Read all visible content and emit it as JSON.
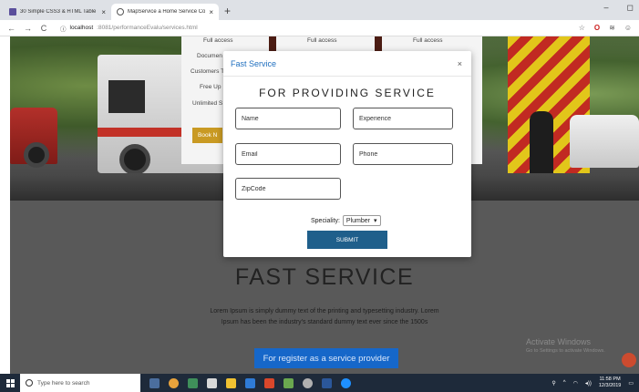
{
  "browser": {
    "tabs": [
      {
        "title": "30 Simple CSS3 & HTML Table St",
        "active": false
      },
      {
        "title": "MapService a Home Service Com",
        "active": true
      }
    ],
    "new_tab": "+",
    "url_host": "localhost",
    "url_path": ":8081/performanceEvalu/services.html",
    "window_controls": [
      "–",
      "◻"
    ]
  },
  "hero": {
    "card_labels": [
      "Full access",
      "Full access",
      "Full access"
    ],
    "card_items": [
      "Documen",
      "Customers T",
      "Free Up",
      "Unlimited S"
    ],
    "card_button": "Book N"
  },
  "section": {
    "title": "FAST SERVICE",
    "lorem": "Lorem Ipsum is simply dummy text of the printing and typesetting industry. Lorem Ipsum has been the industry's standard dummy text ever since the 1500s",
    "register_button": "For register as a service provider"
  },
  "watermark": {
    "title": "Activate Windows",
    "subtitle": "Go to Settings to activate Windows."
  },
  "modal": {
    "title": "Fast Service",
    "close": "×",
    "heading": "FOR PROVIDING SERVICE",
    "fields": {
      "name": "Name",
      "experience": "Experience",
      "email": "Email",
      "phone": "Phone",
      "zipcode": "ZipCode"
    },
    "speciality_label": "Speciality:",
    "speciality_value": "Plumber",
    "submit": "SUBMIT"
  },
  "taskbar": {
    "search_placeholder": "Type here to search",
    "time": "11:58 PM",
    "date": "12/3/2019"
  },
  "colors": {
    "modal_title": "#1f6fbf",
    "submit": "#1f5f8b",
    "register": "#1667c9",
    "book_button": "#c99a23"
  }
}
